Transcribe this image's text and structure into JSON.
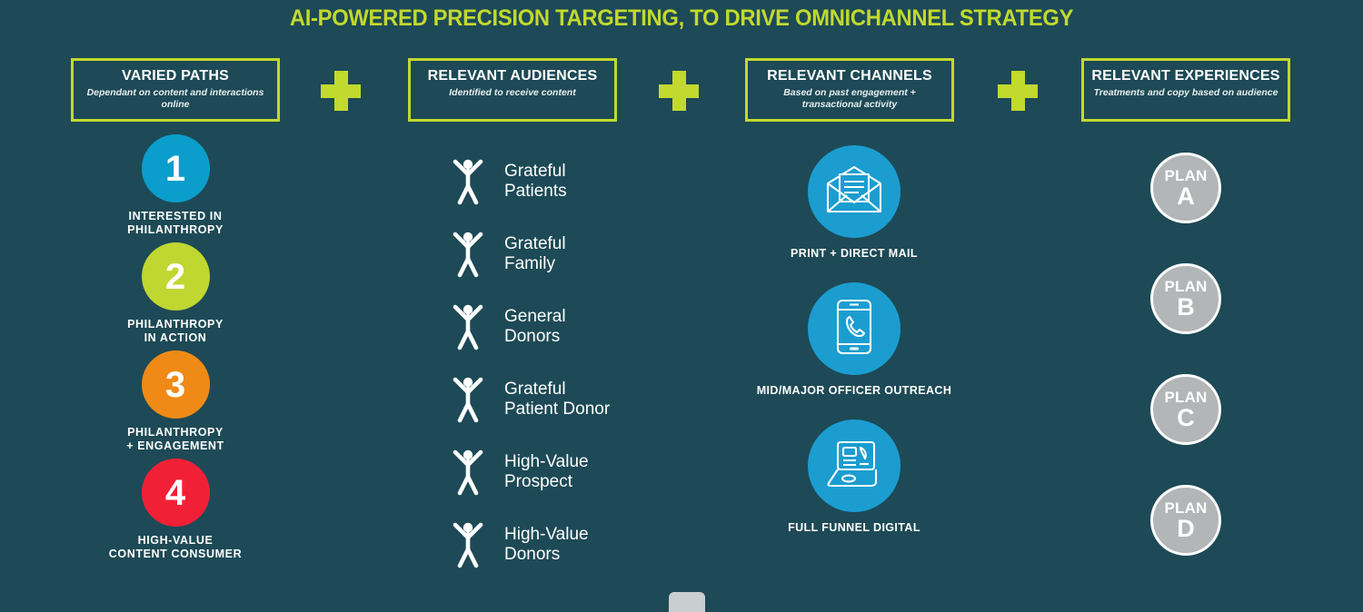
{
  "title": "AI-POWERED PRECISION TARGETING, TO DRIVE OMNICHANNEL STRATEGY",
  "colors": {
    "background": "#1d4a56",
    "accent_lime": "#c2d92e",
    "channel_blue": "#1b9dd0",
    "plan_gray": "#b3b6b7",
    "step1_blue": "#0b9dcc",
    "step2_green": "#bfd730",
    "step3_orange": "#f08a16",
    "step4_red": "#f22036",
    "text_white": "#ffffff"
  },
  "headers": [
    {
      "title": "VARIED PATHS",
      "subtitle": "Dependant on content and\ninteractions online"
    },
    {
      "title": "RELEVANT AUDIENCES",
      "subtitle": "Identified to receive content"
    },
    {
      "title": "RELEVANT CHANNELS",
      "subtitle": "Based on past engagement +\ntransactional activity"
    },
    {
      "title": "RELEVANT EXPERIENCES",
      "subtitle": "Treatments and copy based\non audience"
    }
  ],
  "connectors": [
    {
      "icon": "plus-icon",
      "label": "+"
    },
    {
      "icon": "plus-icon",
      "label": "+"
    },
    {
      "icon": "plus-icon",
      "label": "+"
    }
  ],
  "paths": [
    {
      "number": "1",
      "label": "INTERESTED IN\nPHILANTHROPY",
      "color": "#0b9dcc"
    },
    {
      "number": "2",
      "label": "PHILANTHROPY\nIN ACTION",
      "color": "#bfd730"
    },
    {
      "number": "3",
      "label": "PHILANTHROPY\n+ ENGAGEMENT",
      "color": "#f08a16"
    },
    {
      "number": "4",
      "label": "HIGH-VALUE\nCONTENT CONSUMER",
      "color": "#f22036"
    }
  ],
  "audiences": [
    {
      "label": "Grateful\nPatients",
      "icon": "person-raised-arms-icon"
    },
    {
      "label": "Grateful\nFamily",
      "icon": "person-raised-arms-icon"
    },
    {
      "label": "General\nDonors",
      "icon": "person-raised-arms-icon"
    },
    {
      "label": "Grateful\nPatient Donor",
      "icon": "person-raised-arms-icon"
    },
    {
      "label": "High-Value\nProspect",
      "icon": "person-raised-arms-icon"
    },
    {
      "label": "High-Value\nDonors",
      "icon": "person-raised-arms-icon"
    }
  ],
  "channels": [
    {
      "label": "PRINT + DIRECT MAIL",
      "icon": "open-envelope-letter-icon"
    },
    {
      "label": "MID/MAJOR OFFICER OUTREACH",
      "icon": "mobile-phone-call-icon"
    },
    {
      "label": "FULL FUNNEL DIGITAL",
      "icon": "laptop-icon"
    }
  ],
  "plans": [
    {
      "word": "PLAN",
      "letter": "A"
    },
    {
      "word": "PLAN",
      "letter": "B"
    },
    {
      "word": "PLAN",
      "letter": "C"
    },
    {
      "word": "PLAN",
      "letter": "D"
    }
  ]
}
